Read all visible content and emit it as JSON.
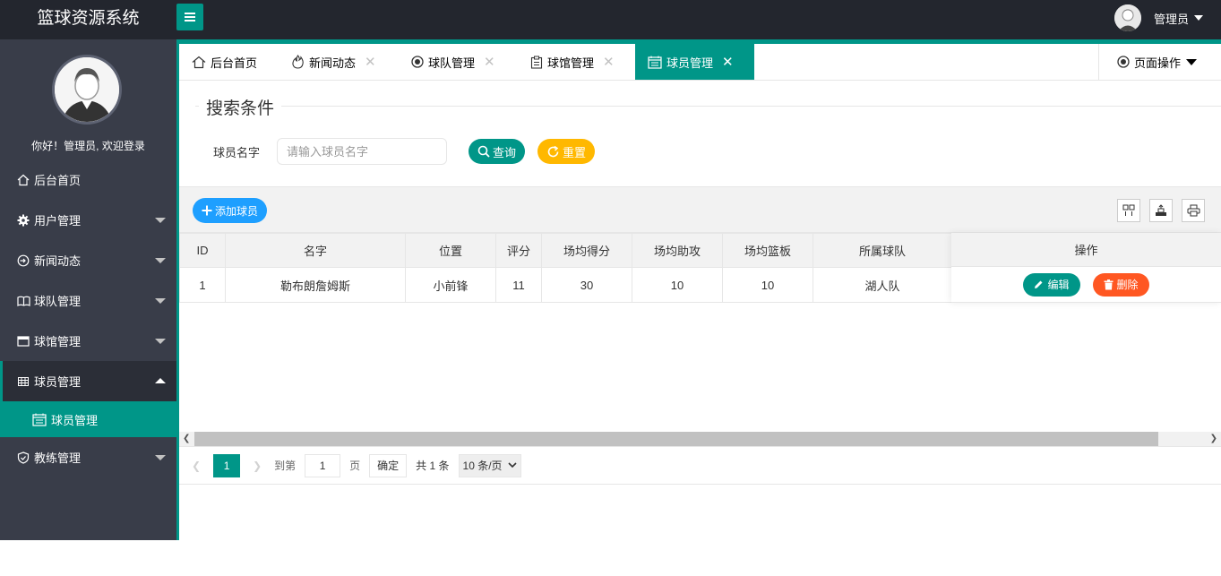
{
  "app": {
    "title": "篮球资源系统"
  },
  "header": {
    "user_name": "管理员"
  },
  "sidebar": {
    "welcome": "你好！管理员, 欢迎登录",
    "items": [
      {
        "label": "后台首页",
        "icon": "home-icon"
      },
      {
        "label": "用户管理",
        "icon": "gear-icon"
      },
      {
        "label": "新闻动态",
        "icon": "login-icon"
      },
      {
        "label": "球队管理",
        "icon": "book-icon"
      },
      {
        "label": "球馆管理",
        "icon": "window-icon"
      },
      {
        "label": "球员管理",
        "icon": "table-icon"
      },
      {
        "label": "教练管理",
        "icon": "shield-icon"
      }
    ],
    "sub_item": {
      "label": "球员管理",
      "icon": "calendar-list-icon"
    }
  },
  "tabs": [
    {
      "label": "后台首页",
      "icon": "home-icon"
    },
    {
      "label": "新闻动态",
      "icon": "fire-icon"
    },
    {
      "label": "球队管理",
      "icon": "radio-icon"
    },
    {
      "label": "球馆管理",
      "icon": "clipboard-icon"
    },
    {
      "label": "球员管理",
      "icon": "calendar-list-icon",
      "active": true
    }
  ],
  "page_ops": {
    "label": "页面操作"
  },
  "search": {
    "legend": "搜索条件",
    "field_label": "球员名字",
    "placeholder": "请输入球员名字",
    "search_label": "查询",
    "reset_label": "重置"
  },
  "toolbar": {
    "add_label": "添加球员"
  },
  "table": {
    "columns": [
      "ID",
      "名字",
      "位置",
      "评分",
      "场均得分",
      "场均助攻",
      "场均篮板",
      "所属球队",
      "操作"
    ],
    "rows": [
      {
        "id": "1",
        "name": "勒布朗詹姆斯",
        "position": "小前锋",
        "rating": "11",
        "points": "30",
        "assists": "10",
        "rebounds": "10",
        "team": "湖人队"
      }
    ],
    "edit_label": "编辑",
    "delete_label": "删除"
  },
  "pager": {
    "current_page": "1",
    "goto_label": "到第",
    "goto_value": "1",
    "page_unit": "页",
    "confirm_label": "确定",
    "total_label": "共 1 条",
    "page_size": "10 条/页"
  },
  "colors": {
    "primary": "#009688",
    "header_bg": "#23262e",
    "sidebar_bg": "#393d49",
    "warn": "#ffb800",
    "danger": "#ff5722",
    "info": "#1e9fff"
  }
}
